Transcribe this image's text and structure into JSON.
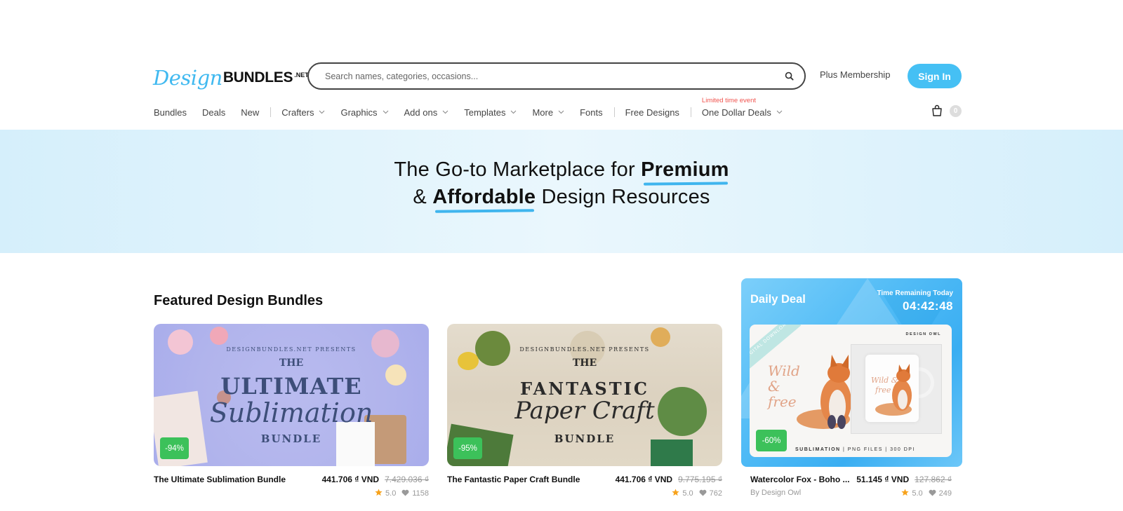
{
  "header": {
    "logo": {
      "design": "Design",
      "bundles": "BUNDLES",
      "net": ".NET"
    },
    "search": {
      "placeholder": "Search names, categories, occasions...",
      "value": "",
      "icon": "search-icon"
    },
    "plus_membership": "Plus Membership",
    "sign_in": "Sign In",
    "cart": {
      "icon": "shopping-bag-icon",
      "count": "0"
    }
  },
  "nav": {
    "items": [
      {
        "label": "Bundles",
        "dropdown": false
      },
      {
        "label": "Deals",
        "dropdown": false
      },
      {
        "label": "New",
        "dropdown": false
      },
      {
        "label": "Crafters",
        "dropdown": true
      },
      {
        "label": "Graphics",
        "dropdown": true
      },
      {
        "label": "Add ons",
        "dropdown": true
      },
      {
        "label": "Templates",
        "dropdown": true
      },
      {
        "label": "More",
        "dropdown": true
      },
      {
        "label": "Fonts",
        "dropdown": false
      },
      {
        "label": "Free Designs",
        "dropdown": false
      },
      {
        "label": "One Dollar Deals",
        "dropdown": true,
        "tag": "Limited time event"
      }
    ]
  },
  "hero": {
    "line1_pre": "The Go-to Marketplace for ",
    "line1_bold": "Premium",
    "line2_pre": "& ",
    "line2_bold": "Affordable",
    "line2_post": " Design Resources"
  },
  "featured": {
    "title": "Featured Design Bundles",
    "cards": [
      {
        "title": "The Ultimate Sublimation Bundle",
        "price": "441.706 ₫ VND",
        "old_price": "7.429.036 ₫",
        "discount": "-94%",
        "rating": "5.0",
        "likes": "1158",
        "poster": {
          "presents": "DESIGNBUNDLES.NET PRESENTS",
          "the": "THE",
          "big": "ULTIMATE",
          "script": "Sublimation",
          "bundle": "BUNDLE"
        }
      },
      {
        "title": "The Fantastic Paper Craft Bundle",
        "price": "441.706 ₫ VND",
        "old_price": "9.775.195 ₫",
        "discount": "-95%",
        "rating": "5.0",
        "likes": "762",
        "poster": {
          "presents": "DESIGNBUNDLES.NET PRESENTS",
          "the": "THE",
          "big": "FANTASTIC",
          "script": "Paper Craft",
          "bundle": "BUNDLE"
        }
      }
    ]
  },
  "daily_deal": {
    "label": "Daily Deal",
    "time_label": "Time Remaining Today",
    "timer": "04:42:48",
    "ribbon": "DIGITAL DOWNLOAD",
    "brand": "DESIGN OWL",
    "image_text": "Wild & free",
    "subtitle_bold": "SUBLIMATION",
    "subtitle_rest": " | PNG FILES | 300 DPI",
    "discount": "-60%",
    "title": "Watercolor Fox - Boho ...",
    "price": "51.145 ₫ VND",
    "old_price": "127.862 ₫",
    "by": "By Design Owl",
    "rating": "5.0",
    "likes": "249"
  },
  "colors": {
    "accent": "#45c0f4",
    "discount": "#3cc15a",
    "limited": "#f0544f",
    "star": "#f7a21b"
  }
}
